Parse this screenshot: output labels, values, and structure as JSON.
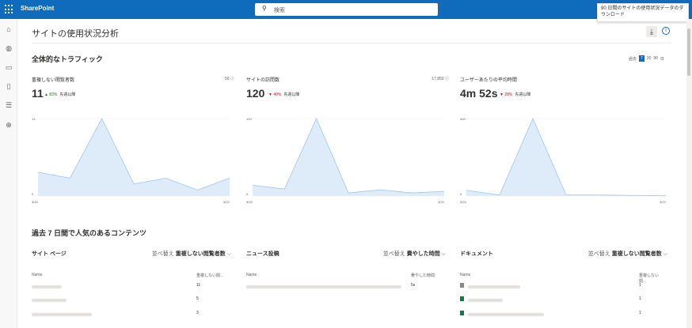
{
  "app": {
    "brand": "SharePoint",
    "search_placeholder": "検索"
  },
  "tooltip": "90 日間のサイトの使用状況データのダウンロード",
  "page": {
    "title": "サイトの使用状況分析"
  },
  "traffic": {
    "title": "全体的なトラフィック",
    "range_label": "過去",
    "ranges": [
      "7",
      "30",
      "90",
      "日"
    ],
    "selected": "7",
    "cards": [
      {
        "label": "重複しない閲覧者数",
        "total": "56",
        "value": "11",
        "delta": "83%",
        "direction": "up",
        "compare": "先週以降",
        "y_top": "13",
        "y_zero": "0",
        "x_start": "3/23",
        "x_end": "3/23",
        "series": [
          4,
          3,
          13,
          2,
          3,
          1,
          3
        ]
      },
      {
        "label": "サイトの訪問数",
        "total": "17,850",
        "value": "120",
        "delta": "40%",
        "direction": "down",
        "compare": "先週以降",
        "y_top": "100",
        "y_zero": "0",
        "x_start": "3/23",
        "x_end": "3/23",
        "series": [
          14,
          9,
          100,
          4,
          8,
          4,
          6
        ]
      },
      {
        "label": "ユーザーあたりの平均時間",
        "total": "",
        "value": "4m 52s",
        "delta": "28%",
        "direction": "down",
        "compare": "先週以降",
        "y_top": "400",
        "y_zero": "0",
        "x_start": "3/23",
        "x_end": "3/23",
        "series": [
          30,
          5,
          400,
          5,
          5,
          3,
          2
        ]
      }
    ]
  },
  "popular": {
    "title": "過去 7 日間で人気のあるコンテンツ",
    "tiles": [
      {
        "heading": "サイト ページ",
        "sort_label": "並べ替え",
        "sort_value": "重複しない閲覧者数",
        "col_name": "Name",
        "col_value": "重複しない閲...",
        "rows": [
          {
            "value": "11"
          },
          {
            "value": "5"
          },
          {
            "value": "3"
          }
        ]
      },
      {
        "heading": "ニュース投稿",
        "sort_label": "並べ替え",
        "sort_value": "費やした時間",
        "col_name": "Name",
        "col_value": "費やした時間",
        "rows": [
          {
            "value": "5s"
          }
        ]
      },
      {
        "heading": "ドキュメント",
        "sort_label": "並べ替え",
        "sort_value": "重複しない閲覧者数",
        "col_name": "Name",
        "col_value": "重複しない閲...",
        "rows": [
          {
            "value": "1"
          },
          {
            "value": "1"
          },
          {
            "value": "1"
          }
        ]
      }
    ]
  },
  "colors": {
    "brand": "#0f6cbd",
    "chart_fill": "#deecf9",
    "chart_line": "#9cc6ee",
    "up": "#107c10",
    "down": "#c50f1f"
  }
}
